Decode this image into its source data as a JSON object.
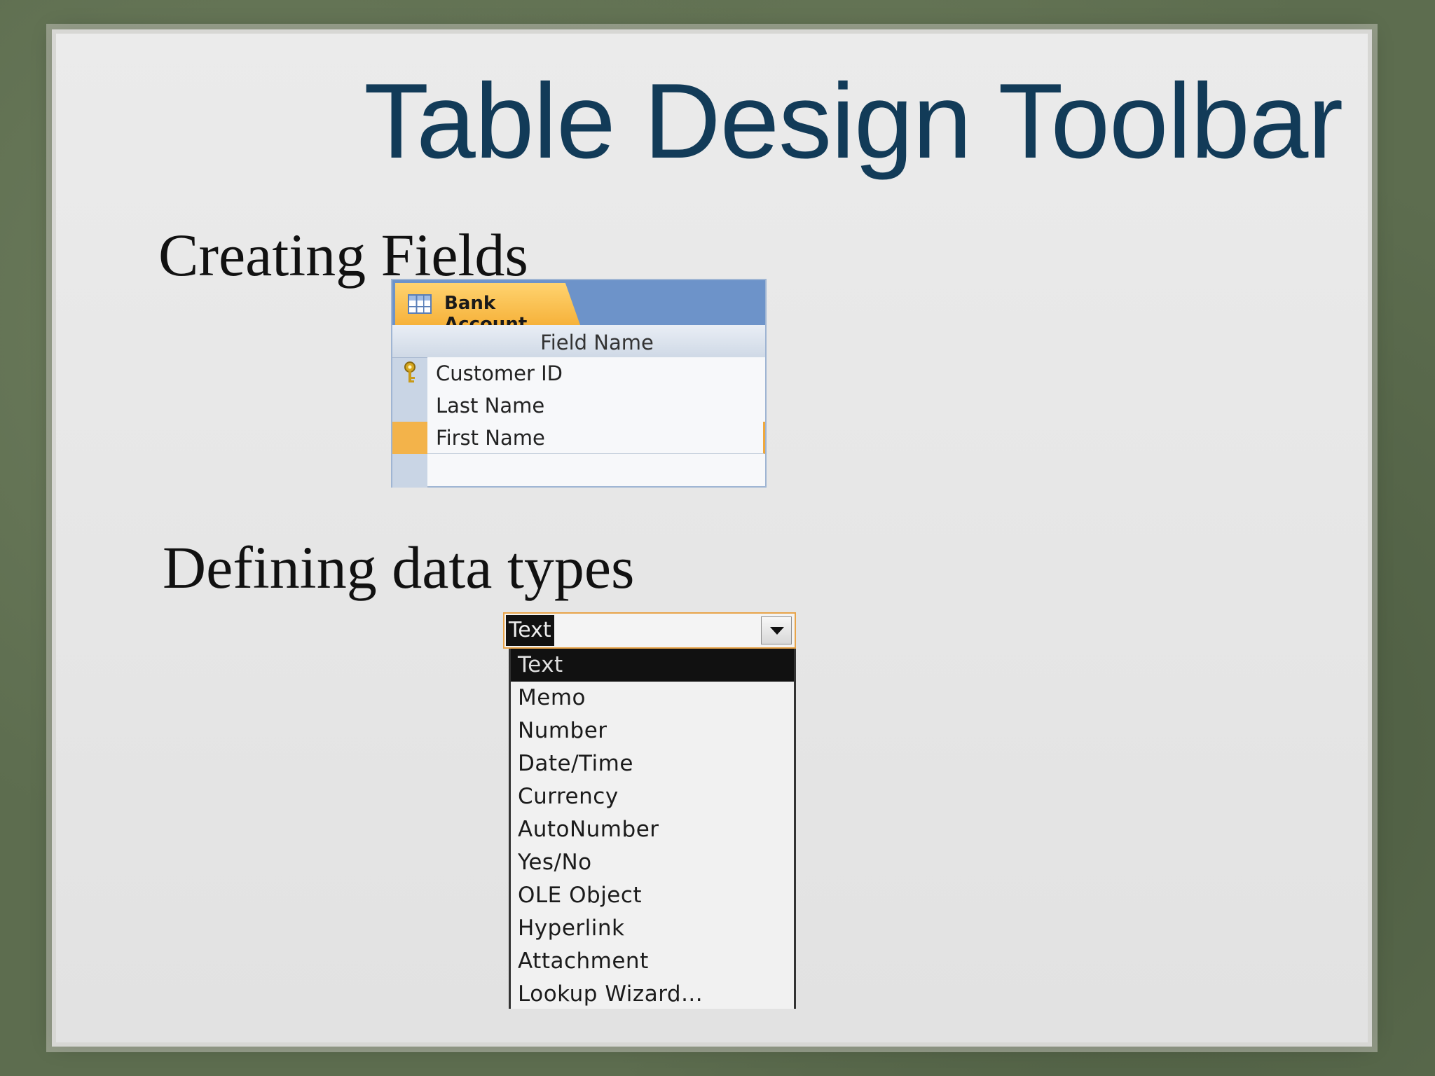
{
  "slide": {
    "title": "Table Design Toolbar",
    "heading_fields": "Creating Fields",
    "heading_types": "Defining data types"
  },
  "table": {
    "tab_title": "Bank Account",
    "column_header": "Field Name",
    "rows": [
      "Customer ID",
      "Last Name",
      "First Name",
      ""
    ]
  },
  "datatype": {
    "current_value": "Text",
    "options": [
      "Text",
      "Memo",
      "Number",
      "Date/Time",
      "Currency",
      "AutoNumber",
      "Yes/No",
      "OLE Object",
      "Hyperlink",
      "Attachment",
      "Lookup Wizard..."
    ]
  },
  "icons": {
    "table": "table-icon",
    "key": "primary-key-icon",
    "dropdown": "chevron-down-icon"
  },
  "colors": {
    "title": "#123b58",
    "tab_orange": "#f6b23b",
    "header_blue": "#6d93c9",
    "selection_black": "#111111"
  }
}
